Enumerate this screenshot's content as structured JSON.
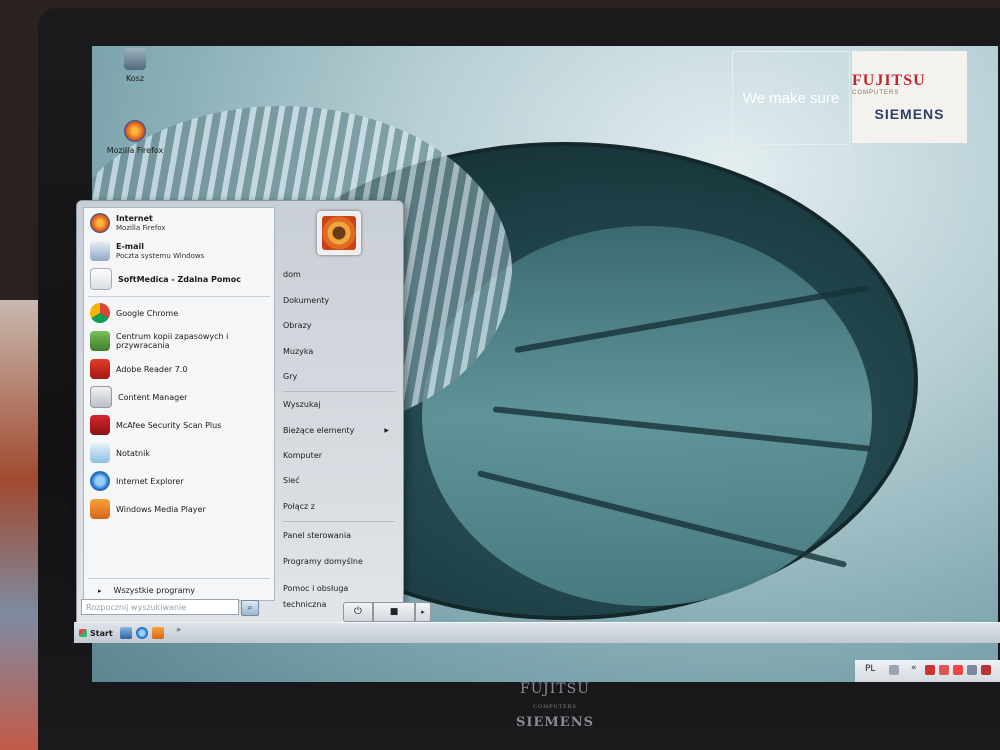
{
  "desktop": {
    "wallpaper_banner": {
      "tagline": "We make sure",
      "brand_top": "FUJITSU",
      "brand_top_small": "COMPUTERS",
      "brand_bottom": "SIEMENS"
    },
    "icons": [
      {
        "label": "Kosz",
        "icon": "recycle-bin-icon"
      },
      {
        "label": "Mozilla Firefox",
        "icon": "firefox-icon"
      }
    ]
  },
  "bezel": {
    "brand_line1": "FUJITSU",
    "brand_small": "COMPUTERS",
    "brand_line2": "SIEMENS"
  },
  "start_menu": {
    "pinned": [
      {
        "title": "Internet",
        "subtitle": "Mozilla Firefox",
        "icon": "firefox-icon"
      },
      {
        "title": "E-mail",
        "subtitle": "Poczta systemu Windows",
        "icon": "mail-icon"
      },
      {
        "title": "SoftMedica - Zdalna Pomoc",
        "subtitle": "",
        "icon": "document-icon"
      }
    ],
    "programs": [
      {
        "label": "Google Chrome",
        "icon": "chrome-icon"
      },
      {
        "label": "Centrum kopii zapasowych i przywracania",
        "icon": "backup-icon"
      },
      {
        "label": "Adobe Reader 7.0",
        "icon": "adobe-reader-icon"
      },
      {
        "label": "Content Manager",
        "icon": "content-manager-icon"
      },
      {
        "label": "McAfee Security Scan Plus",
        "icon": "mcafee-icon"
      },
      {
        "label": "Notatnik",
        "icon": "notepad-icon"
      },
      {
        "label": "Internet Explorer",
        "icon": "internet-explorer-icon"
      },
      {
        "label": "Windows Media Player",
        "icon": "media-player-icon"
      }
    ],
    "all_programs": "Wszystkie programy",
    "search_placeholder": "Rozpocznij wyszukiwanie",
    "right_links": [
      "dom",
      "Dokumenty",
      "Obrazy",
      "Muzyka",
      "Gry",
      "Wyszukaj",
      "Bieżące elementy",
      "Komputer",
      "Sieć",
      "Połącz z",
      "Panel sterowania",
      "Programy domyślne",
      "Pomoc i obsługa techniczna"
    ]
  },
  "taskbar": {
    "start_label": "Start",
    "more": "»"
  },
  "tray": {
    "language": "PL",
    "chevron": "«"
  }
}
